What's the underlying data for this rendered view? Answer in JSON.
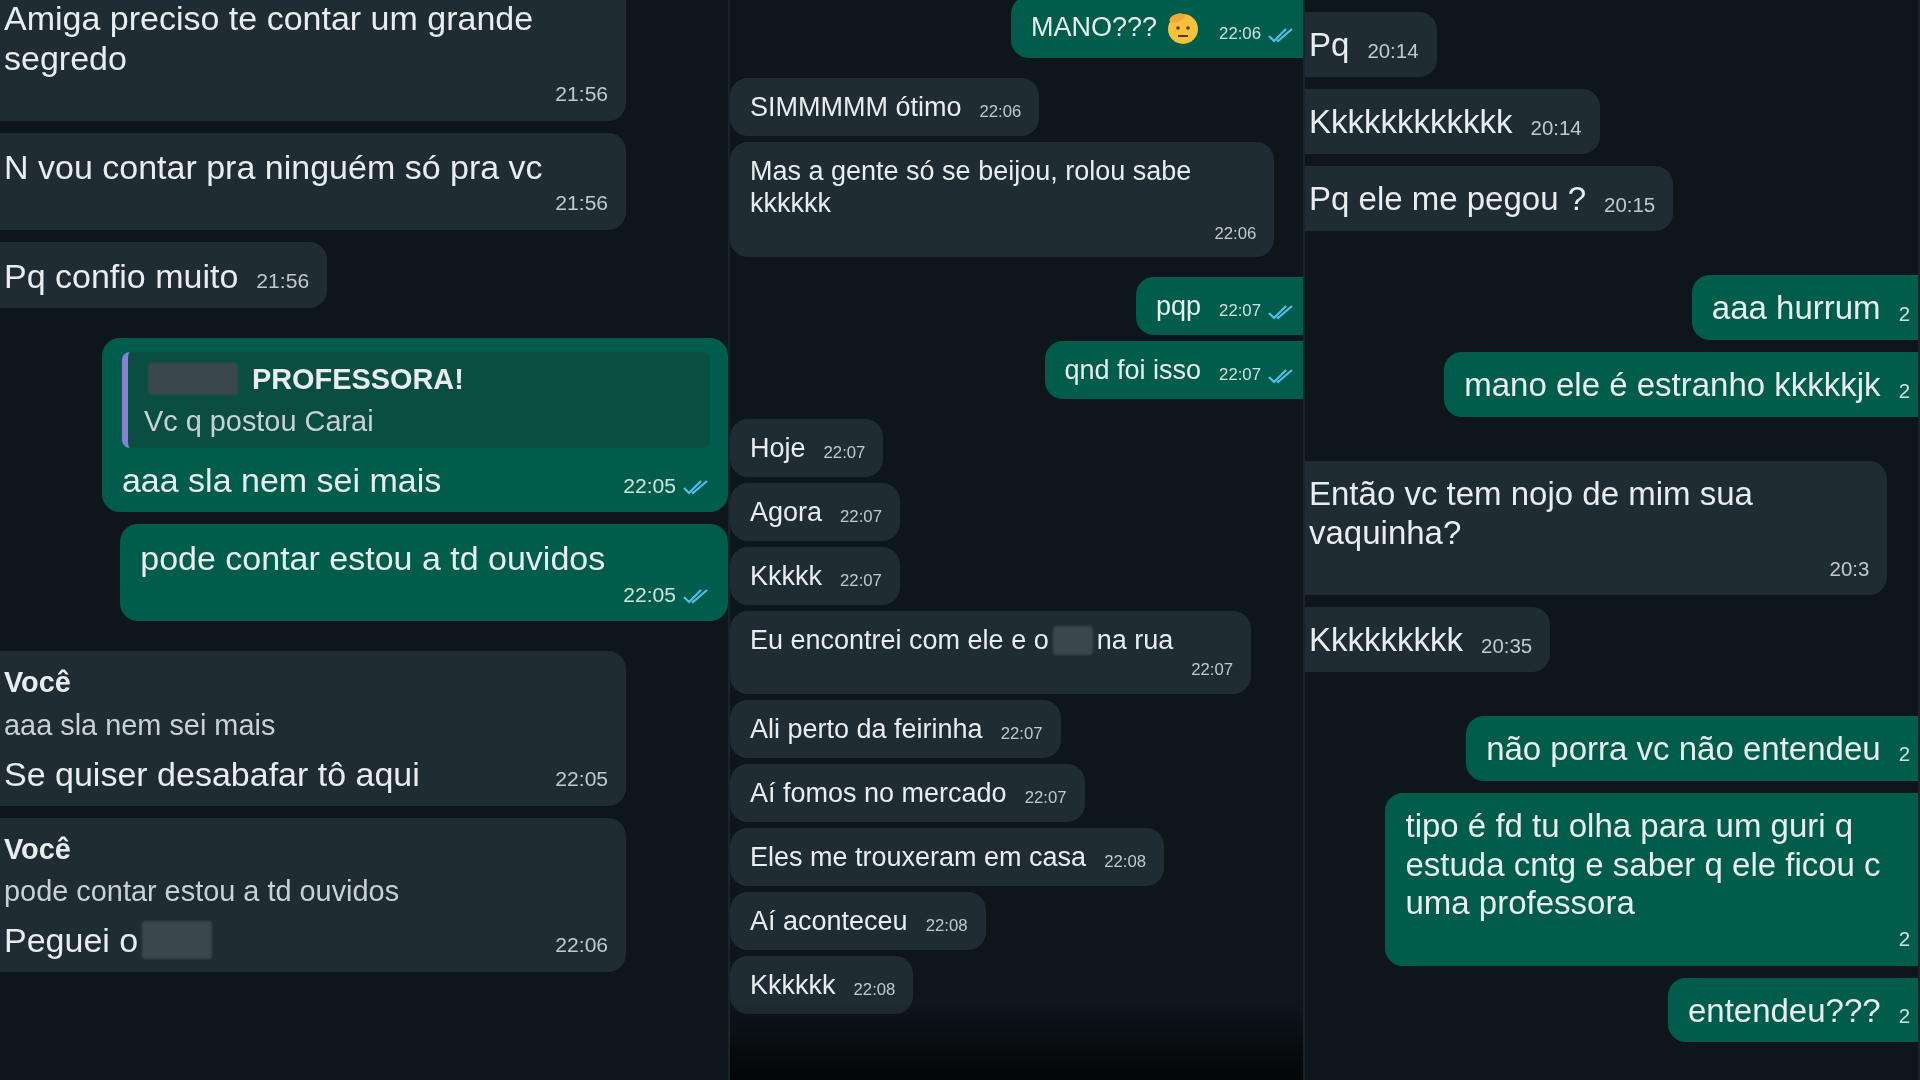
{
  "panels": [
    {
      "messages": [
        {
          "outgoing": false,
          "text": "Amiga preciso te contar um grande segredo",
          "time": "21:56"
        },
        {
          "outgoing": false,
          "text": "N vou contar pra ninguém só pra vc",
          "time": "21:56"
        },
        {
          "outgoing": false,
          "text": "Pq confio muito",
          "time": "21:56"
        },
        {
          "outgoing": true,
          "quote": {
            "author": "PROFESSORA!",
            "author_redacted": true,
            "text": "Vc q postou Carai"
          },
          "text": "aaa sla nem sei mais",
          "time": "22:05",
          "read": true
        },
        {
          "outgoing": true,
          "text": "pode contar estou a td ouvidos",
          "time": "22:05",
          "read": true
        },
        {
          "outgoing": false,
          "quote": {
            "author": "Você",
            "text": "aaa sla nem sei mais"
          },
          "text": "Se quiser desabafar tô aqui",
          "time": "22:05"
        },
        {
          "outgoing": false,
          "quote": {
            "author": "Você",
            "text": "pode contar estou a td ouvidos"
          },
          "text": "Peguei o",
          "redacted": true,
          "time": "22:06"
        }
      ]
    },
    {
      "messages": [
        {
          "outgoing": true,
          "text": "MANO???",
          "emoji": true,
          "time": "22:06",
          "read": true
        },
        {
          "outgoing": false,
          "text": "SIMMMMM ótimo",
          "time": "22:06"
        },
        {
          "outgoing": false,
          "text": "Mas a gente só se beijou, rolou sabe kkkkkk",
          "time": "22:06"
        },
        {
          "outgoing": true,
          "text": "pqp",
          "time": "22:07",
          "read": true
        },
        {
          "outgoing": true,
          "text": "qnd foi isso",
          "time": "22:07",
          "read": true
        },
        {
          "outgoing": false,
          "text": "Hoje",
          "time": "22:07"
        },
        {
          "outgoing": false,
          "text": "Agora",
          "time": "22:07"
        },
        {
          "outgoing": false,
          "text": "Kkkkk",
          "time": "22:07"
        },
        {
          "outgoing": false,
          "text": "Eu encontrei com ele e o",
          "redacted": true,
          "text_after": "na rua",
          "time": "22:07"
        },
        {
          "outgoing": false,
          "text": "Ali perto da feirinha",
          "time": "22:07"
        },
        {
          "outgoing": false,
          "text": "Aí fomos no mercado",
          "time": "22:07"
        },
        {
          "outgoing": false,
          "text": "Eles me trouxeram em casa",
          "time": "22:08"
        },
        {
          "outgoing": false,
          "text": "Aí aconteceu",
          "time": "22:08"
        },
        {
          "outgoing": false,
          "text": "Kkkkkk",
          "time": "22:08"
        }
      ]
    },
    {
      "messages": [
        {
          "outgoing": false,
          "text": "Pq",
          "time": "20:14"
        },
        {
          "outgoing": false,
          "text": "Kkkkkkkkkkkk",
          "time": "20:14"
        },
        {
          "outgoing": false,
          "text": "Pq ele me pegou ?",
          "time": "20:15"
        },
        {
          "outgoing": true,
          "text": "aaa hurrum",
          "time": "2"
        },
        {
          "outgoing": true,
          "text": "mano ele é estranho kkkkkjk",
          "time": "2"
        },
        {
          "outgoing": false,
          "text": "Então vc tem nojo de mim sua vaquinha?",
          "time": "20:3"
        },
        {
          "outgoing": false,
          "text": "Kkkkkkkkk",
          "time": "20:35"
        },
        {
          "outgoing": true,
          "text": "não porra vc não entendeu",
          "time": "2"
        },
        {
          "outgoing": true,
          "text_lines": [
            "tipo é fd tu olha para um guri q",
            "estuda cntg e saber q ele ficou c",
            "uma professora"
          ],
          "time": "2"
        },
        {
          "outgoing": true,
          "text": "entendeu???",
          "time": "2"
        }
      ]
    }
  ]
}
